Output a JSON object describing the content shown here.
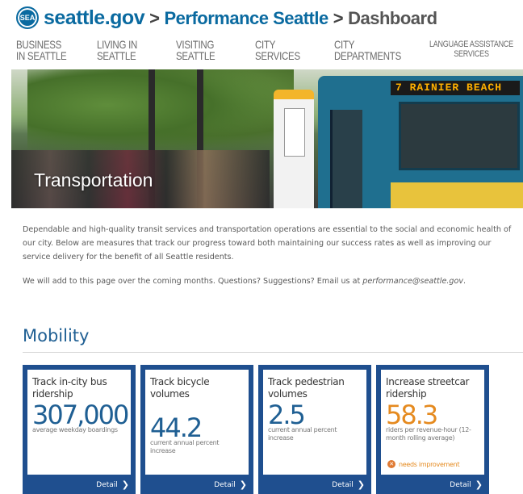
{
  "header": {
    "site": "seattle.gov",
    "separator": ">",
    "section": "Performance Seattle",
    "page": "Dashboard",
    "logo_text": "SEA"
  },
  "nav": {
    "items": [
      {
        "line1": "Business",
        "line2": "in Seattle"
      },
      {
        "line1": "Living in",
        "line2": "Seattle"
      },
      {
        "line1": "Visiting",
        "line2": "Seattle"
      },
      {
        "line1": "City",
        "line2": "Services"
      },
      {
        "line1": "City",
        "line2": "Departments"
      },
      {
        "line1": "Language Assistance",
        "line2": "Services"
      }
    ]
  },
  "hero": {
    "title": "Transportation",
    "bus_sign": "7  RAINIER BEACH"
  },
  "intro": {
    "paragraph1": "Dependable and high-quality transit services and transportation operations are essential to the social and economic health of our city. Below are measures that track our progress toward both maintaining our success rates as well as improving our service delivery for the benefit of all Seattle residents.",
    "paragraph2_prefix": "We will add to this page over the coming months. Questions? Suggestions? Email us at ",
    "email": "performance@seattle.gov",
    "paragraph2_suffix": "."
  },
  "section": {
    "title": "Mobility"
  },
  "cards": [
    {
      "title": "Track in-city bus ridership",
      "value": "307,000",
      "desc": "average weekday boardings",
      "footer": "Detail"
    },
    {
      "title": "Track bicycle volumes",
      "value": "44.2",
      "desc": "current annual percent increase",
      "footer": "Detail"
    },
    {
      "title": "Track pedestrian volumes",
      "value": "2.5",
      "desc": "current annual percent increase",
      "footer": "Detail"
    },
    {
      "title": "Increase streetcar ridership",
      "value": "58.3",
      "desc": "riders per revenue-hour (12-month rolling average)",
      "status": "needs improvement",
      "footer": "Detail"
    }
  ],
  "colors": {
    "brand_blue": "#0a6aa0",
    "card_border": "#1f4f8f",
    "value_blue": "#1f5f93",
    "value_orange": "#e58a1f"
  }
}
